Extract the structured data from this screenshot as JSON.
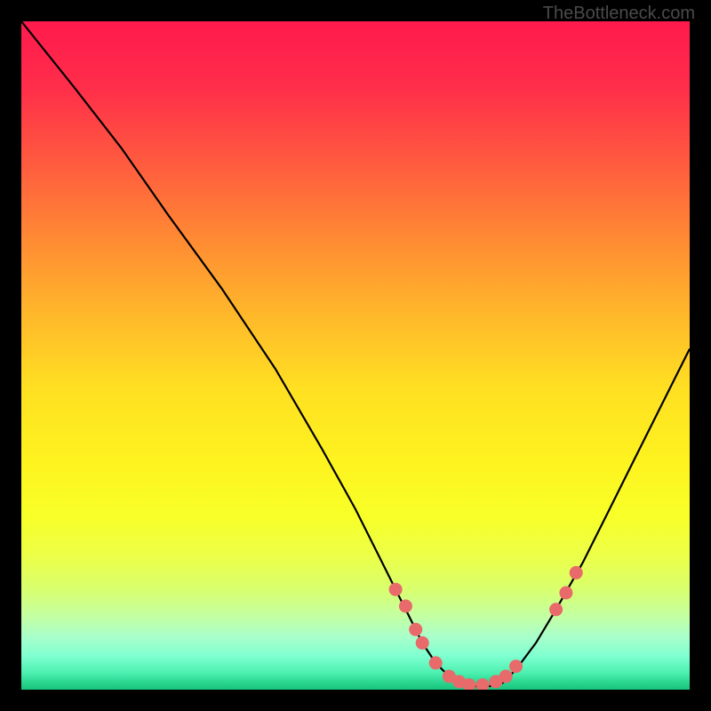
{
  "watermark": "TheBottleneck.com",
  "chart_data": {
    "type": "line",
    "title": "",
    "xlabel": "",
    "ylabel": "",
    "xlim": [
      0,
      100
    ],
    "ylim": [
      0,
      100
    ],
    "curve": {
      "name": "bottleneck-curve",
      "x": [
        0,
        4,
        8,
        15,
        22,
        30,
        38,
        45,
        50,
        53,
        56,
        58,
        60,
        62,
        64,
        66,
        68,
        70,
        72,
        74,
        77,
        80,
        84,
        88,
        92,
        96,
        100
      ],
      "y": [
        100,
        95,
        90,
        81,
        71,
        60,
        48,
        36,
        27,
        21,
        15,
        11,
        7,
        4,
        2,
        1,
        0.5,
        0.5,
        1,
        3,
        7,
        12,
        19,
        27,
        35,
        43,
        51
      ]
    },
    "dots": {
      "name": "highlight-points",
      "x": [
        56,
        57.5,
        59,
        60,
        62,
        64,
        65.5,
        67,
        69,
        71,
        72.5,
        74,
        80,
        81.5,
        83
      ],
      "y": [
        15,
        12.5,
        9,
        7,
        4,
        2,
        1.2,
        0.7,
        0.7,
        1.2,
        2,
        3.5,
        12,
        14.5,
        17.5
      ]
    }
  }
}
